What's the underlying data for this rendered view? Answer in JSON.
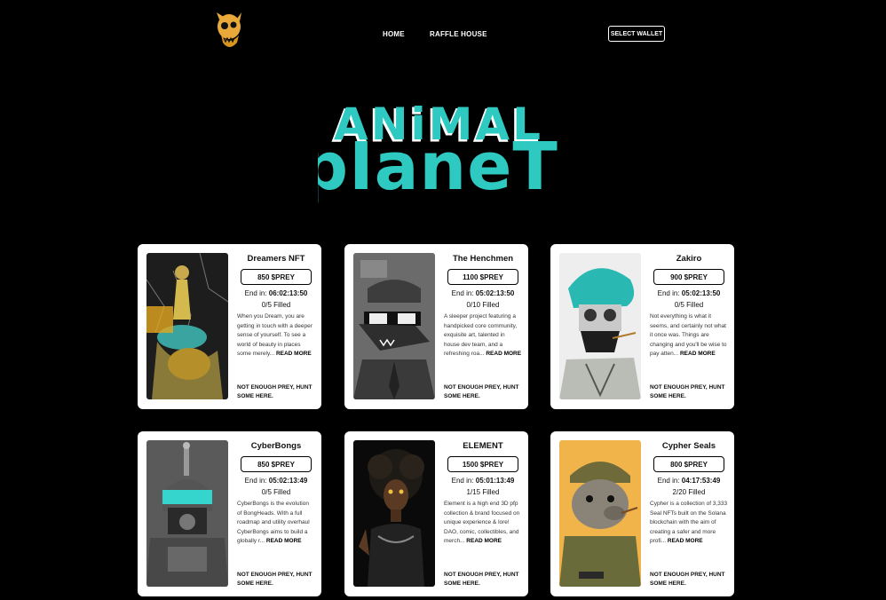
{
  "nav": {
    "home": "HOME",
    "raffle_house": "RAFFLE HOUSE",
    "select_wallet": "SELECT WALLET",
    "logo_icon": "animal-skull-logo-icon"
  },
  "hero": {
    "title_line1": "ANiMAL",
    "title_line2": "pIaneT"
  },
  "colors": {
    "accent": "#2ec9c0",
    "background": "#000000",
    "card": "#ffffff"
  },
  "cards": [
    {
      "name": "Dreamers NFT",
      "price": "850 $PREY",
      "end_label": "End in:",
      "end_time": "06:02:13:50",
      "filled": "0/5 Filled",
      "desc": "When you Dream, you are getting in touch with a deeper sense of yourself. To see a world of beauty in places some merely...",
      "read_more": "READ MORE",
      "hunt": "NOT ENOUGH PREY, HUNT SOME HERE."
    },
    {
      "name": "The Henchmen",
      "price": "1100 $PREY",
      "end_label": "End in:",
      "end_time": "05:02:13:50",
      "filled": "0/10 Filled",
      "desc": "A sleeper project featuring a handpicked core community, exquisite art, talented in house dev team, and a refreshing roa...",
      "read_more": "READ MORE",
      "hunt": "NOT ENOUGH PREY, HUNT SOME HERE."
    },
    {
      "name": "Zakiro",
      "price": "900 $PREY",
      "end_label": "End in:",
      "end_time": "05:02:13:50",
      "filled": "0/5 Filled",
      "desc": "Not everything is what it seems, and certainly not what it once was. Things are changing and you'll be wise to pay atten...",
      "read_more": "READ MORE",
      "hunt": "NOT ENOUGH PREY, HUNT SOME HERE."
    },
    {
      "name": "CyberBongs",
      "price": "850 $PREY",
      "end_label": "End in:",
      "end_time": "05:02:13:49",
      "filled": "0/5 Filled",
      "desc": "CyberBongs is the evolution of BongHeads. With a full roadmap and utility overhaul CyberBongs aims to build a globally r...",
      "read_more": "READ MORE",
      "hunt": "NOT ENOUGH PREY, HUNT SOME HERE."
    },
    {
      "name": "ELEMENT",
      "price": "1500 $PREY",
      "end_label": "End in:",
      "end_time": "05:01:13:49",
      "filled": "1/15 Filled",
      "desc": "Element is a high end 3D pfp collection & brand focused on unique experience & lore! DAO, comic, collectibles, and merch...",
      "read_more": "READ MORE",
      "hunt": "NOT ENOUGH PREY, HUNT SOME HERE."
    },
    {
      "name": "Cypher Seals",
      "price": "800 $PREY",
      "end_label": "End in:",
      "end_time": "04:17:53:49",
      "filled": "2/20 Filled",
      "desc": "Cypher is a collection of 3,333 Seal NFTs built on the Solana blockchain with the aim of creating a safer and more profi...",
      "read_more": "READ MORE",
      "hunt": "NOT ENOUGH PREY, HUNT SOME HERE."
    }
  ]
}
